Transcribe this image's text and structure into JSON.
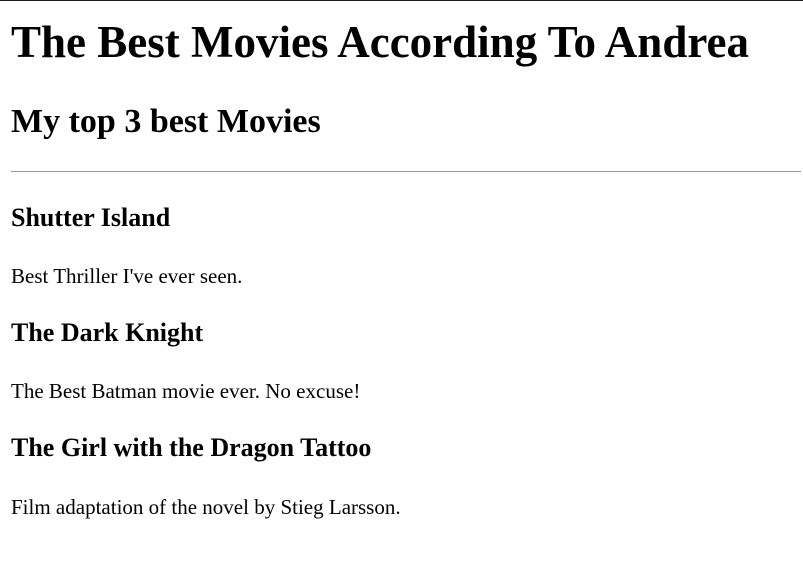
{
  "page": {
    "title": "The Best Movies According To Andrea",
    "subtitle": "My top 3 best Movies"
  },
  "movies": [
    {
      "title": "Shutter Island",
      "description": "Best Thriller I've ever seen."
    },
    {
      "title": "The Dark Knight",
      "description": "The Best Batman movie ever. No excuse!"
    },
    {
      "title": "The Girl with the Dragon Tattoo",
      "description": "Film adaptation of the novel by Stieg Larsson."
    }
  ],
  "colors": {
    "text": "#000000",
    "divider": "#9a9a9a",
    "background": "#ffffff"
  }
}
